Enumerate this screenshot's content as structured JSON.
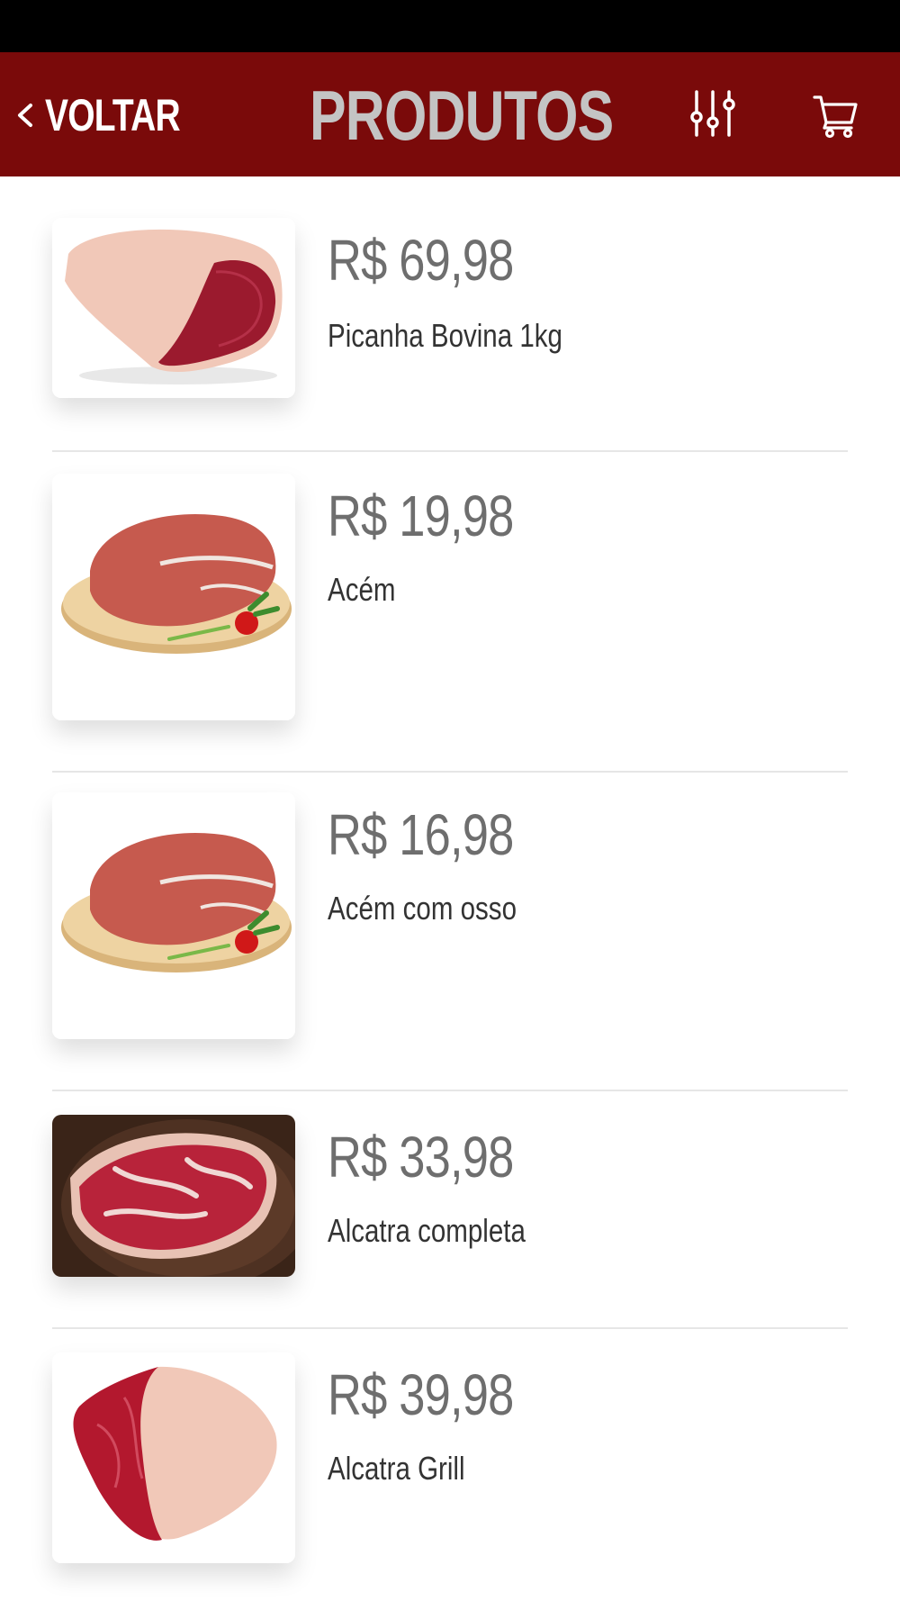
{
  "header": {
    "back_label": "VOLTAR",
    "title": "PRODUTOS",
    "filter_icon": "sliders-icon",
    "cart_icon": "cart-icon",
    "bar_color": "#7a0a0a",
    "title_color": "#c4c4c4"
  },
  "products": [
    {
      "price": "R$ 69,98",
      "name": "Picanha Bovina 1kg",
      "image": "picanha-image"
    },
    {
      "price": "R$ 19,98",
      "name": "Acém",
      "image": "acem-image"
    },
    {
      "price": "R$ 16,98",
      "name": "Acém com osso",
      "image": "acem-com-osso-image"
    },
    {
      "price": "R$ 33,98",
      "name": "Alcatra completa",
      "image": "alcatra-completa-image"
    },
    {
      "price": "R$ 39,98",
      "name": "Alcatra Grill",
      "image": "alcatra-grill-image"
    }
  ]
}
